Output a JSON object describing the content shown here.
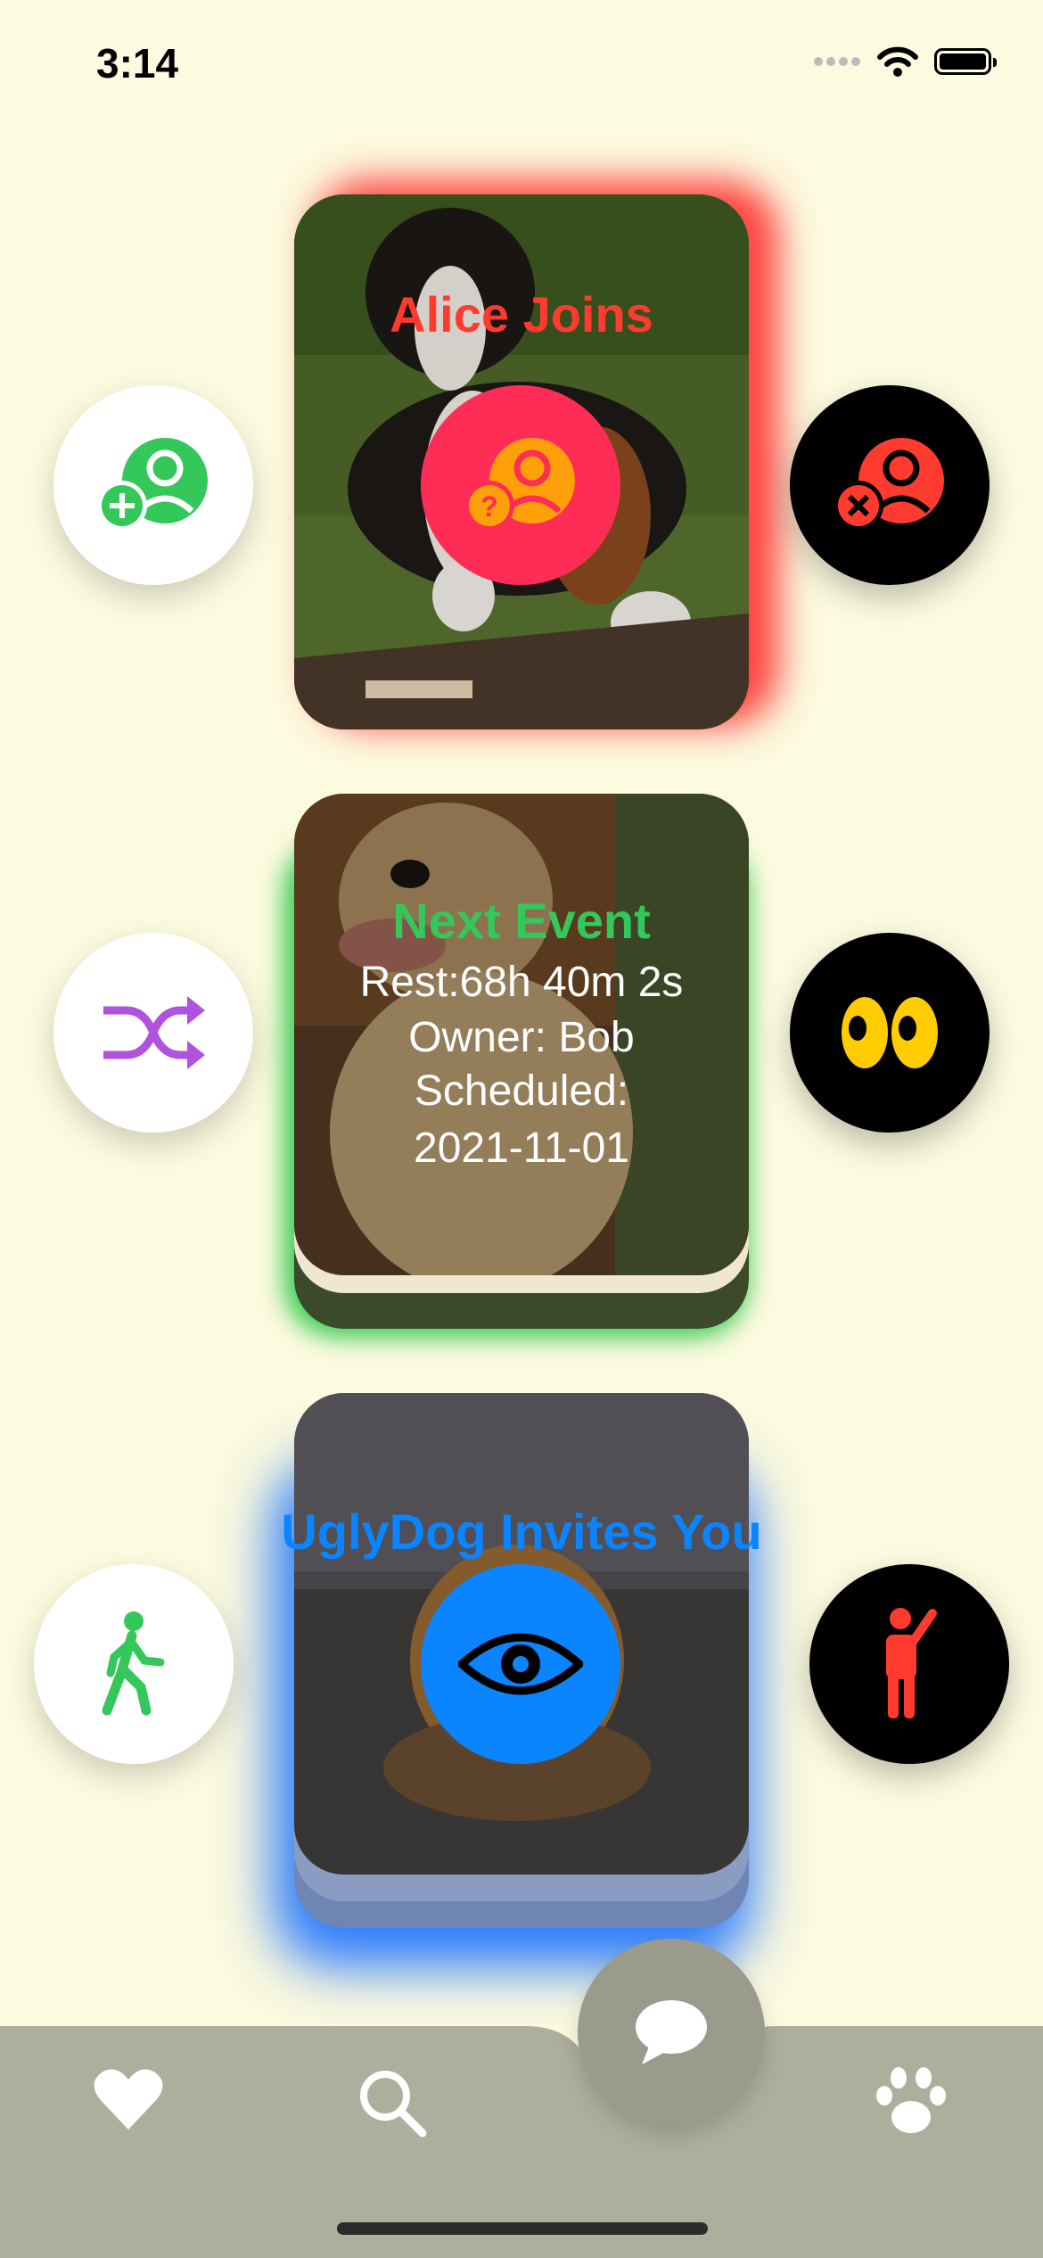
{
  "status_bar": {
    "time": "3:14"
  },
  "cards": [
    {
      "title": "Alice Joins",
      "title_color": "#FF3B30",
      "glow": "red"
    },
    {
      "title": "Next Event",
      "title_color": "#34C759",
      "lines": [
        "Rest:68h 40m 2s",
        "Owner: Bob",
        "Scheduled:",
        "2021-11-01"
      ],
      "glow": "green"
    },
    {
      "title": "UglyDog Invites You",
      "title_color": "#0A84FF",
      "glow": "blue"
    }
  ],
  "actions": [
    {
      "left_icon": "person-add-icon",
      "center_icon": "person-question-icon",
      "right_icon": "person-remove-icon"
    },
    {
      "left_icon": "shuffle-icon",
      "right_icon": "eyes-icon"
    },
    {
      "left_icon": "walking-person-icon",
      "center_icon": "eye-icon",
      "right_icon": "raised-hand-person-icon"
    }
  ],
  "tab_bar": {
    "items": [
      "heart-icon",
      "search-icon",
      "chat-bubble-icon",
      "paw-icon"
    ],
    "selected": "chat-bubble-icon"
  },
  "colors": {
    "background": "#FCFADF",
    "tab_bar": "#ADAE9B",
    "red": "#FF3B30",
    "green": "#34C759",
    "blue": "#0A84FF",
    "orange": "#FF9F0A",
    "purple": "#AF52DE",
    "pink": "#FF2D55",
    "yellow": "#FFCC00"
  }
}
